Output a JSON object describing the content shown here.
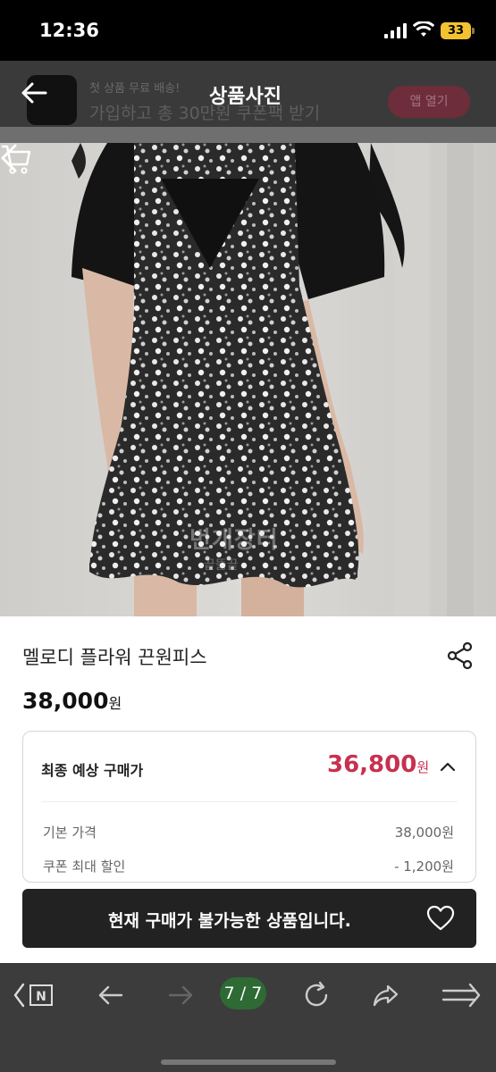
{
  "status_bar": {
    "time": "12:36",
    "battery": "33"
  },
  "app_banner": {
    "small_text": "첫 상품 무료 배송!",
    "big_text": "가입하고 총 30만원 쿠폰팩 받기",
    "button_label": "앱 열기"
  },
  "viewer": {
    "title": "상품사진"
  },
  "photo": {
    "watermark": "번개장터",
    "watermark_sub": "끝뚫끝"
  },
  "product": {
    "name": "멜로디 플라워 끈원피스",
    "price": "38,000",
    "currency": "원"
  },
  "summary": {
    "label": "최종 예상 구매가",
    "price": "36,800",
    "currency": "원",
    "rows": [
      {
        "label": "기본 가격",
        "value": "38,000원"
      },
      {
        "label": "쿠폰 최대 할인",
        "value": "- 1,200원"
      }
    ]
  },
  "buy_bar": {
    "text": "현재 구매가 불가능한 상품입니다."
  },
  "browser": {
    "page_counter": "7 / 7"
  },
  "colors": {
    "accent_price": "#c8304f",
    "buy_bar": "#222222",
    "page_counter": "#2e6a33"
  }
}
